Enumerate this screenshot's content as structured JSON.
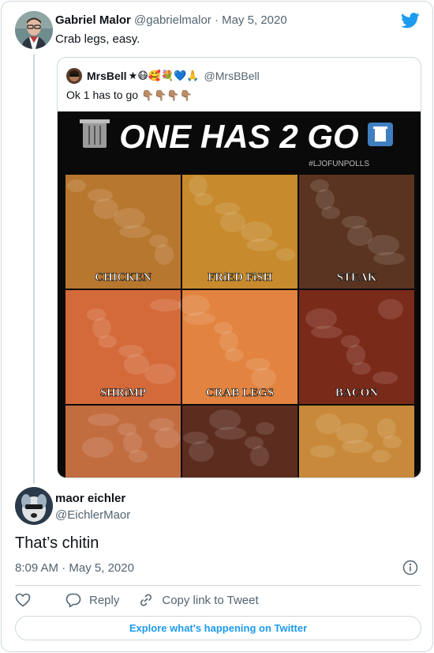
{
  "tweet": {
    "author_name": "Gabriel Malor",
    "handle": "@gabrielmalor",
    "separator": "·",
    "date": "May 5, 2020",
    "text": "Crab legs, easy.",
    "avatar_icon": "avatar-man-glasses"
  },
  "quoted": {
    "author_name": "MrsBell",
    "name_emojis": "★😷🥰💐💙🙏",
    "handle": "@MrsBBell",
    "text": "Ok 1 has to go",
    "text_emojis": "👇🏽👇🏽👇🏽👇🏽",
    "image": {
      "title": "ONE HAS 2 GO",
      "hashtag": "#LJOFUNPOLLS",
      "cells": [
        {
          "label": "CHICKEN",
          "color": "#b8772f"
        },
        {
          "label": "FRiED FiSH",
          "color": "#c78a2c"
        },
        {
          "label": "STEAK",
          "color": "#5a3420"
        },
        {
          "label": "SHRiMP",
          "color": "#d46a3a"
        },
        {
          "label": "CRAB LEGS",
          "color": "#e2833f"
        },
        {
          "label": "BACON",
          "color": "#7a2a18"
        },
        {
          "label": "",
          "color": "#c26d40"
        },
        {
          "label": "",
          "color": "#5c2c1e"
        },
        {
          "label": "",
          "color": "#c88a3a"
        }
      ]
    }
  },
  "reply": {
    "author_name": "maor eichler",
    "handle": "@EichlerMaor",
    "text": "That’s chitin",
    "time": "8:09 AM",
    "separator": "·",
    "date": "May 5, 2020",
    "avatar_icon": "avatar-dog"
  },
  "actions": {
    "reply_label": "Reply",
    "copy_label": "Copy link to Tweet"
  },
  "explore_label": "Explore what's happening on Twitter",
  "colors": {
    "accent": "#1d9bf0",
    "muted": "#536471",
    "border": "#cfd9de"
  }
}
